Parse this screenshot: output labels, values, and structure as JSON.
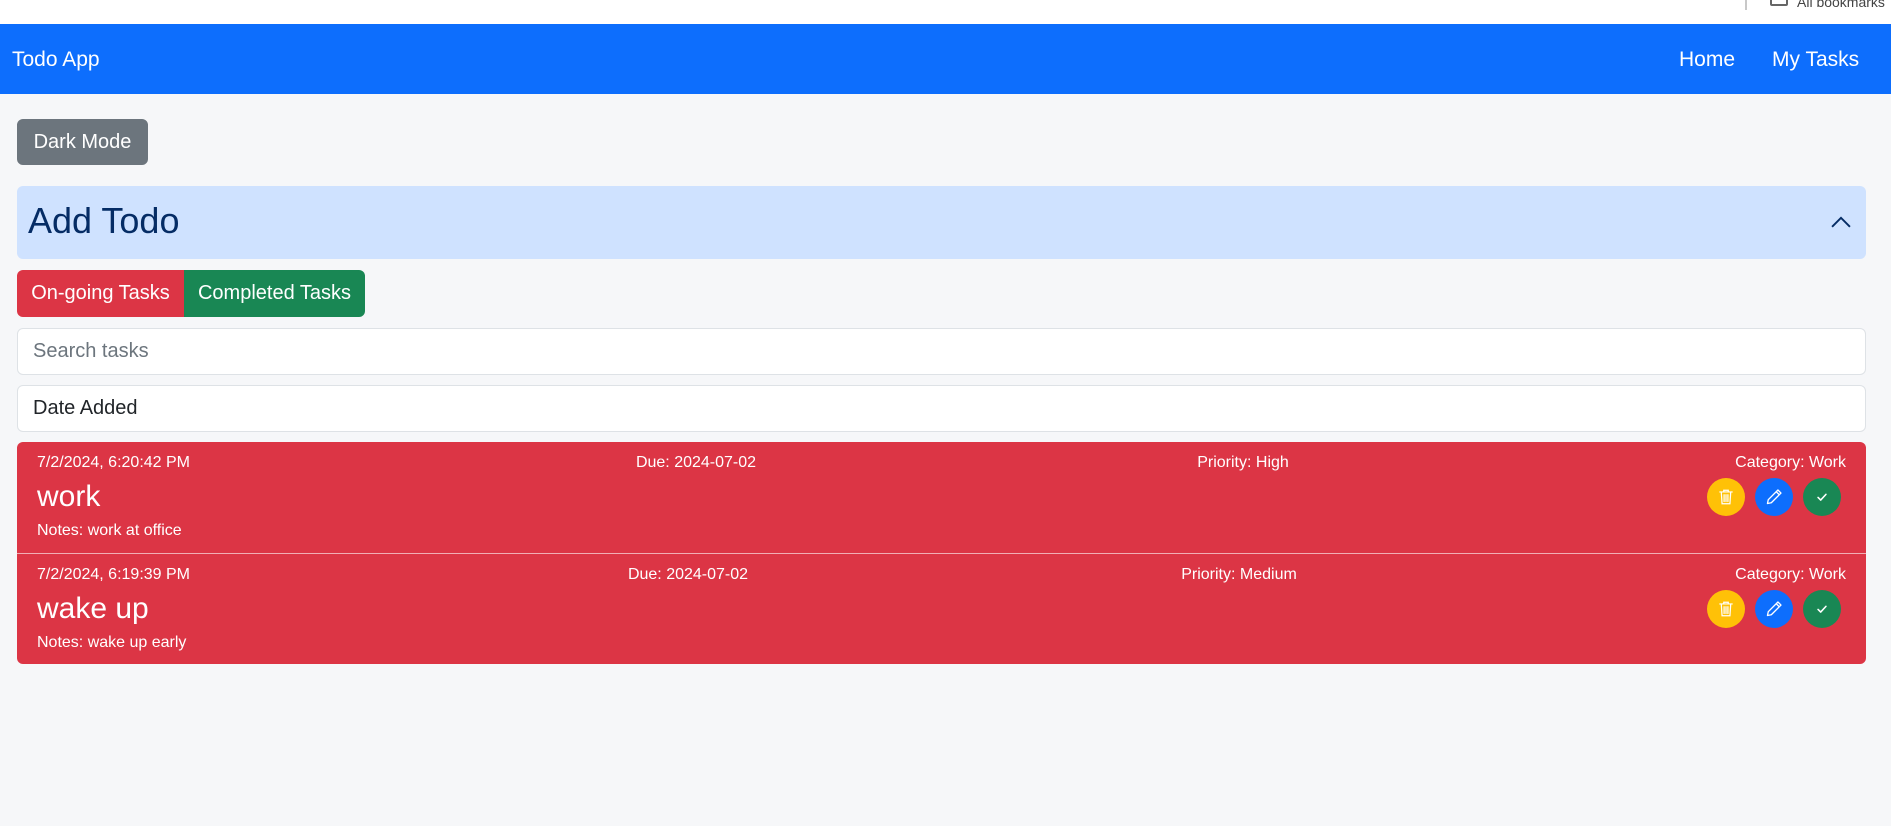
{
  "browser": {
    "bookmarks_label": "All bookmarks"
  },
  "navbar": {
    "brand": "Todo App",
    "links": [
      "Home",
      "My Tasks"
    ]
  },
  "dark_mode_button": "Dark Mode",
  "add_todo": {
    "title": "Add Todo",
    "expanded": true
  },
  "tabs": {
    "ongoing": "On-going Tasks",
    "completed": "Completed Tasks"
  },
  "search": {
    "placeholder": "Search tasks",
    "value": ""
  },
  "sort": {
    "selected": "Date Added"
  },
  "tasks": [
    {
      "added": "7/2/2024, 6:20:42 PM",
      "due": "Due: 2024-07-02",
      "priority": "Priority: High",
      "category": "Category: Work",
      "title": "work",
      "notes": "Notes: work at office"
    },
    {
      "added": "7/2/2024, 6:19:39 PM",
      "due": "Due: 2024-07-02",
      "priority": "Priority: Medium",
      "category": "Category: Work",
      "title": "wake up",
      "notes": "Notes: wake up early"
    }
  ],
  "colors": {
    "primary": "#0d6efd",
    "danger": "#dc3545",
    "success": "#198754",
    "warning": "#ffc107",
    "secondary": "#6c757d",
    "accordion_bg": "#cfe2ff"
  },
  "icons": {
    "delete": "trash-icon",
    "edit": "pencil-icon",
    "complete": "check-icon",
    "accordion": "chevron-up-icon"
  }
}
